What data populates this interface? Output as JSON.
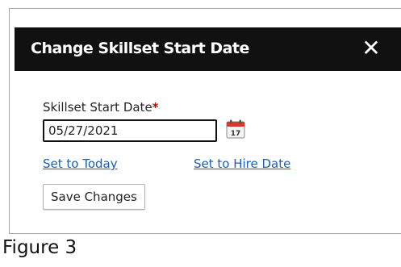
{
  "dialog": {
    "title": "Change Skillset Start Date",
    "close_icon": "close-icon",
    "close_glyph": "✕"
  },
  "form": {
    "label": "Skillset Start Date",
    "required_marker": "*",
    "date_value": "05/27/2021",
    "calendar_icon": "calendar-icon",
    "calendar_day": "17"
  },
  "links": {
    "set_today": "Set to Today",
    "set_hire_date": "Set to Hire Date"
  },
  "buttons": {
    "save_label": "Save Changes"
  },
  "caption": "Figure 3",
  "colors": {
    "header_bg": "#111111",
    "link": "#1a5fb4",
    "required": "#cc0000",
    "calendar_red": "#d83a2a"
  }
}
